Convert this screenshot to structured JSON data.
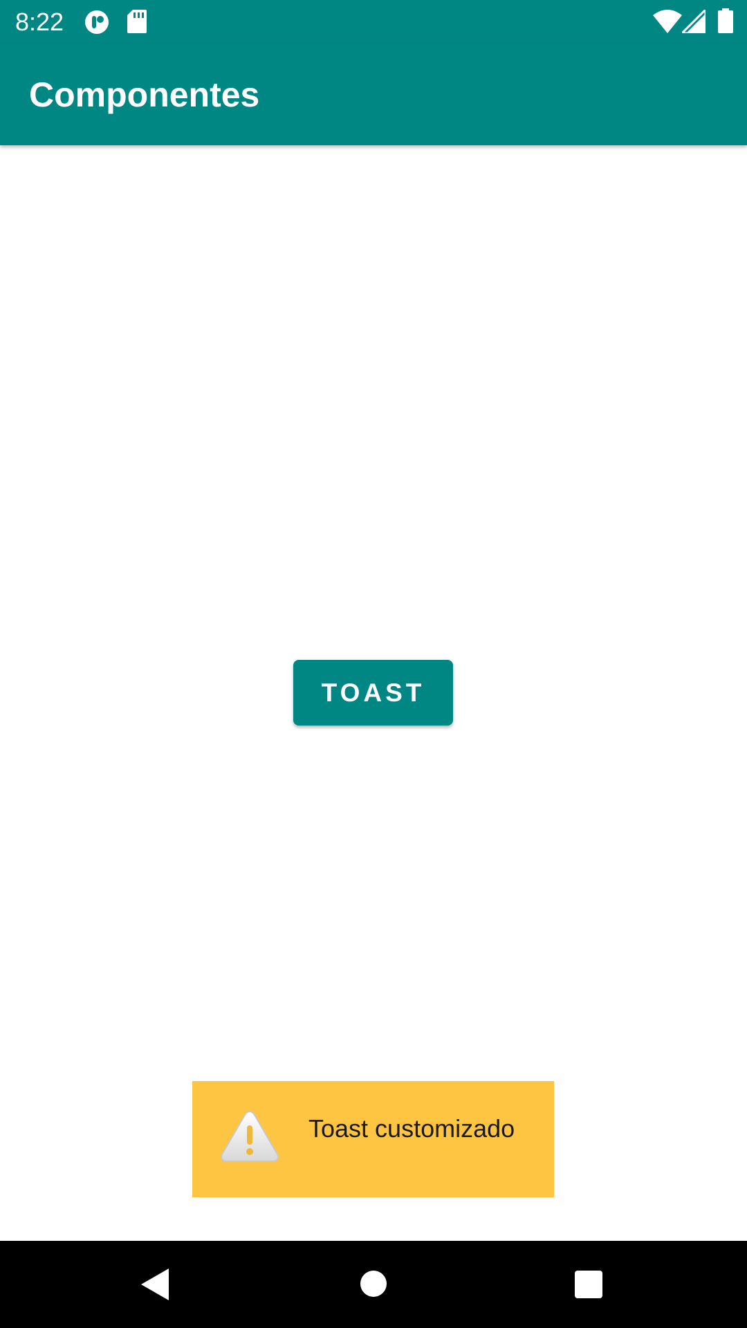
{
  "status_bar": {
    "time": "8:22",
    "icons": [
      "app-notification-icon",
      "sd-card-icon",
      "wifi-icon",
      "cell-signal-icon",
      "battery-icon"
    ],
    "color": "#008784"
  },
  "app_bar": {
    "title": "Componentes",
    "color": "#008784"
  },
  "main": {
    "button_label": "TOAST"
  },
  "toast": {
    "icon": "warning-icon",
    "message": "Toast customizado",
    "background": "#fec542"
  },
  "nav_bar": {
    "buttons": [
      "back-icon",
      "home-icon",
      "recents-icon"
    ]
  }
}
